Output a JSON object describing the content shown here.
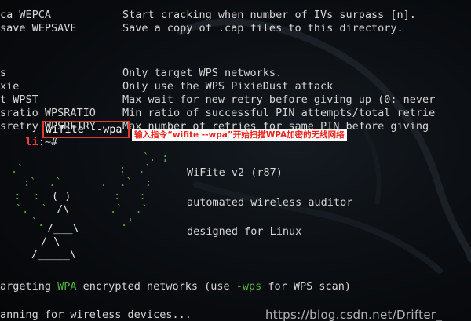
{
  "help_rows_top": [
    {
      "option": "ca WEPCA",
      "description": "Start cracking when number of IVs surpass [n]."
    },
    {
      "option": "save WEPSAVE",
      "description": "Save a copy of .cap files to this directory."
    }
  ],
  "help_rows_wps": [
    {
      "option": "s",
      "description": "Only target WPS networks."
    },
    {
      "option": "xie",
      "description": "Only use the WPS PixieDust attack"
    },
    {
      "option": "t WPST",
      "description": "Max wait for new retry before giving up (0: never"
    },
    {
      "option": "sratio WPSRATIO",
      "description": "Min ratio of successful PIN attempts/total retrie"
    },
    {
      "option": "sretry WPSRETRY",
      "description": "Max number of retries for same PIN before giving"
    }
  ],
  "prompt": {
    "user": "li",
    "rest": ":~# ",
    "command": "wifite --wpa"
  },
  "annotation": "输入指令“wifite --wpa”开始扫描WPA加密的无线网络",
  "ascii_art": {
    "green_row1": "`. ;",
    "green_row2": ".`  :.",
    "green_row3": ":  ()  :",
    "green_row4": "`.  /\\  .'",
    "white_row1": "( )",
    "white_row2": "/\\",
    "white_row3": "/___\\",
    "white_row4": "/ \\",
    "white_row5": "/_____\\"
  },
  "banner": {
    "title": "WiFite v2 (r87)",
    "tagline": "automated wireless auditor",
    "platform": "designed for Linux"
  },
  "status": {
    "targeting_prefix": "argeting ",
    "encryption": "WPA",
    "targeting_middle": " encrypted networks (use ",
    "flag": "-wps",
    "targeting_suffix": " for WPS scan)",
    "scanning": "anning for wireless devices..."
  },
  "watermark": "https://blog.csdn.net/Drifter_",
  "colors": {
    "accent_red": "#e23a2e",
    "green": "#4fb23b",
    "annotation_text": "#e8231f"
  }
}
